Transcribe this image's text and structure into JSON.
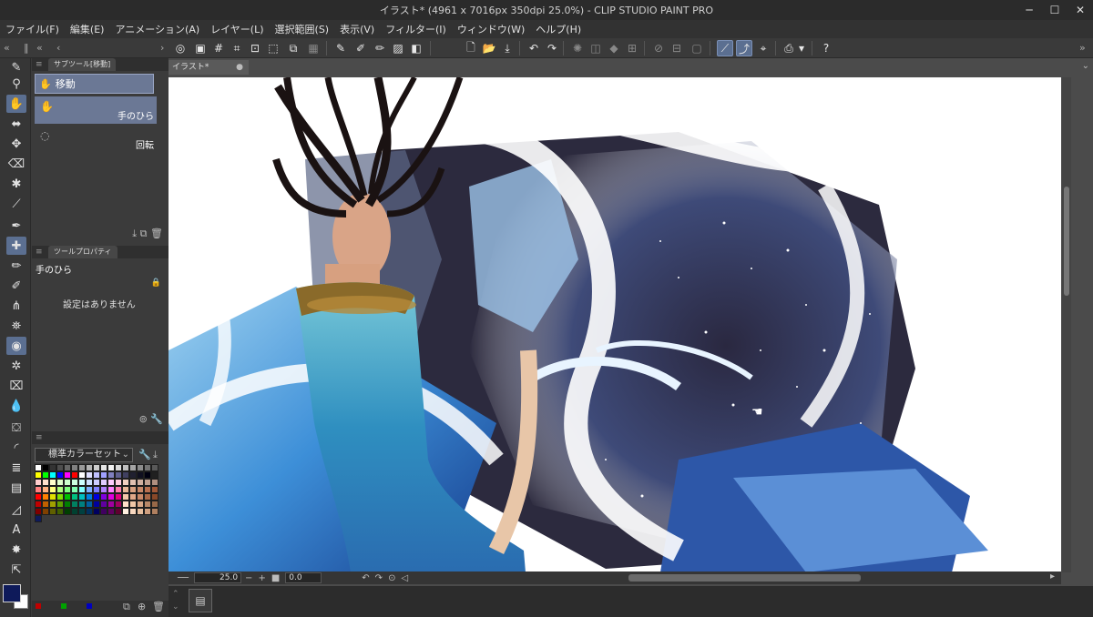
{
  "window": {
    "title": "イラスト* (4961 x 7016px 350dpi 25.0%) - CLIP STUDIO PAINT PRO"
  },
  "menu": [
    "ファイル(F)",
    "編集(E)",
    "アニメーション(A)",
    "レイヤー(L)",
    "選択範囲(S)",
    "表示(V)",
    "フィルター(I)",
    "ウィンドウ(W)",
    "ヘルプ(H)"
  ],
  "subtool_panel": {
    "tab": "サブツール[移動]",
    "group": "移動",
    "items": [
      {
        "name": "手のひら",
        "icon": "hand-icon",
        "selected": true
      },
      {
        "name": "回転",
        "icon": "rotate-icon",
        "selected": false
      }
    ]
  },
  "tool_property": {
    "tab": "ツールプロパティ",
    "tool_name": "手のひら",
    "empty_message": "設定はありません"
  },
  "color_set": {
    "selected": "標準カラーセット",
    "colors": [
      "#ffffff",
      "#000000",
      "#333333",
      "#4d4d4d",
      "#666666",
      "#808080",
      "#999999",
      "#b3b3b3",
      "#cccccc",
      "#e6e6e6",
      "#f2f2f2",
      "#d9d9d9",
      "#bfbfbf",
      "#a6a6a6",
      "#8c8c8c",
      "#737373",
      "#595959",
      "#ffff00",
      "#00ff00",
      "#00ffff",
      "#0000ff",
      "#ff00ff",
      "#ff0000",
      "#ffffff",
      "#e0e0ff",
      "#c0c0ff",
      "#a0a0ff",
      "#8080c0",
      "#606090",
      "#404060",
      "#202030",
      "#101020",
      "#000010",
      "#202020",
      "#ffcccc",
      "#ffe0cc",
      "#ffffcc",
      "#e0ffcc",
      "#ccffcc",
      "#ccffe0",
      "#ccffff",
      "#cce0ff",
      "#ccccff",
      "#e0ccff",
      "#ffccff",
      "#ffcce0",
      "#f0d0c0",
      "#e0c0b0",
      "#d0b0a0",
      "#c0a090",
      "#b09080",
      "#ff8080",
      "#ffb080",
      "#ffff80",
      "#b0ff80",
      "#80ff80",
      "#80ffb0",
      "#80ffff",
      "#80b0ff",
      "#8080ff",
      "#b080ff",
      "#ff80ff",
      "#ff80b0",
      "#e8b898",
      "#d8a080",
      "#c88868",
      "#b87050",
      "#a05838",
      "#ff0000",
      "#ff8000",
      "#e0e000",
      "#80e000",
      "#00c000",
      "#00c080",
      "#00c0c0",
      "#0080e0",
      "#0000e0",
      "#8000e0",
      "#e000e0",
      "#e00080",
      "#f4c8a8",
      "#e0a888",
      "#c88868",
      "#a86848",
      "#884828",
      "#c00000",
      "#c06000",
      "#a0a000",
      "#60a000",
      "#008000",
      "#008060",
      "#008080",
      "#0060a0",
      "#0000a0",
      "#6000a0",
      "#a000a0",
      "#a00060",
      "#ffe0c8",
      "#f0c8a8",
      "#d8a888",
      "#b88868",
      "#986848",
      "#800000",
      "#804000",
      "#606000",
      "#406000",
      "#004000",
      "#004030",
      "#004040",
      "#003060",
      "#000060",
      "#400060",
      "#600060",
      "#600030",
      "#fff0e0",
      "#f8d8c0",
      "#e8c0a0",
      "#d0a080",
      "#b08060",
      "#0e1a5a"
    ]
  },
  "document": {
    "tab": "イラスト*",
    "zoom": "25.0",
    "rotation": "0.0"
  },
  "footer_colors": [
    "#c00000",
    "#00a000",
    "#0000c0"
  ]
}
